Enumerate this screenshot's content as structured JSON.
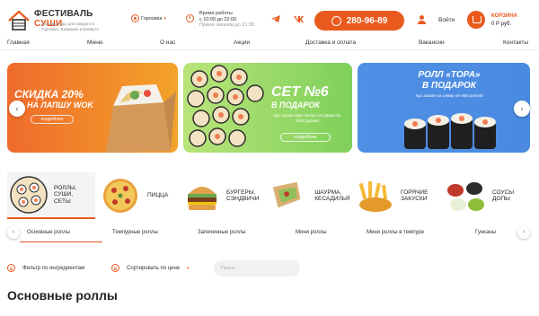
{
  "header": {
    "logo_name_part1": "ФЕСТИВАЛЬ",
    "logo_name_part2": "СУШИ",
    "logo_tagline": "доставка еды для каждого в Горловке, Енакиево и Бахмуте",
    "city": "Горловка",
    "hours_title": "Время работы",
    "hours_line1": "с 10:00 до 22:00",
    "hours_line2": "Прием заказов до 21:30",
    "phone": "280-96-89",
    "login_label": "Войти",
    "cart_label": "КОРЗИНА",
    "cart_total": "0 Р руб."
  },
  "nav": {
    "items": [
      "Главная",
      "Меню",
      "О нас",
      "Акции",
      "Доставка и оплата",
      "Вакансии",
      "Контакты"
    ]
  },
  "banners": [
    {
      "title_line1": "СКИДКА 20%",
      "title_line2": "НА ЛАПШУ WOK",
      "button": "подробнее"
    },
    {
      "title_line1": "СЕТ №6",
      "title_line2": "В ПОДАРОК",
      "note": "при заказе двух сетов на сумму от 2000 рублей",
      "button": "подробнее"
    },
    {
      "title_line1": "РОЛЛ «ТОРА»",
      "title_line2": "В ПОДАРОК",
      "note": "при заказе на сумму от 900 рублей"
    }
  ],
  "categories": [
    {
      "label": "РОЛЛЫ, СУШИ, СЕТЫ"
    },
    {
      "label": "ПИЦЦА"
    },
    {
      "label": "БУРГЕРЫ, СЭНДВИЧИ"
    },
    {
      "label": "ШАУРМА, КЕСАДИЛЬЯ"
    },
    {
      "label": "ГОРЯЧИЕ ЗАКУСКИ"
    },
    {
      "label": "СОУСЫ ДОПЫ"
    }
  ],
  "subcategories": [
    "Основные роллы",
    "Темпурные роллы",
    "Запеченные роллы",
    "Мини роллы",
    "Мини роллы в темпуре",
    "Гунканы"
  ],
  "filters": {
    "ingredients": "Фильтр по ингредиентам",
    "sort": "Сортировать по цене",
    "search_placeholder": "Поиск"
  },
  "section_title": "Основные роллы",
  "colors": {
    "accent": "#ea5a1e"
  }
}
